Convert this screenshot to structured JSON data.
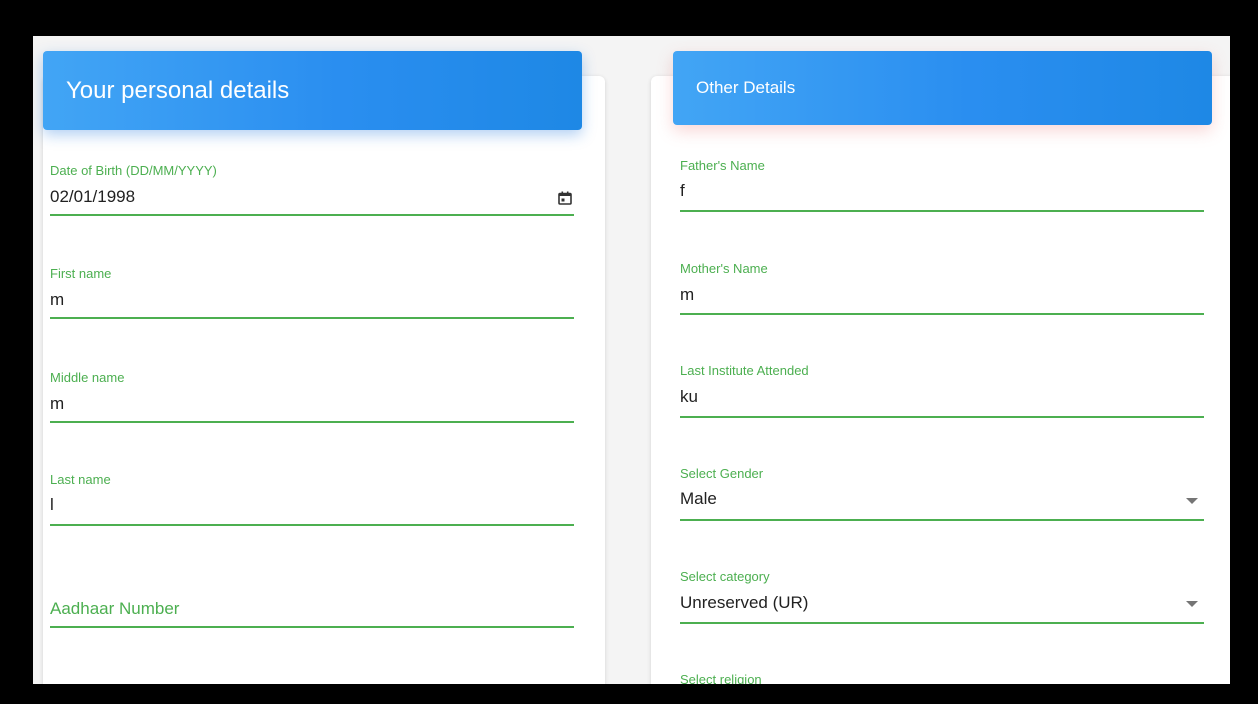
{
  "personal": {
    "title": "Your personal details",
    "dob": {
      "label": "Date of Birth (DD/MM/YYYY)",
      "value": "02/01/1998"
    },
    "first_name": {
      "label": "First name",
      "value": "m"
    },
    "middle_name": {
      "label": "Middle name",
      "value": "m"
    },
    "last_name": {
      "label": "Last name",
      "value": "l"
    },
    "aadhaar": {
      "label": "Aadhaar Number"
    }
  },
  "other": {
    "title": "Other Details",
    "father": {
      "label": "Father's Name",
      "value": "f"
    },
    "mother": {
      "label": "Mother's Name",
      "value": "m"
    },
    "institute": {
      "label": "Last Institute Attended",
      "value": "ku"
    },
    "gender": {
      "label": "Select Gender",
      "value": "Male"
    },
    "category": {
      "label": "Select category",
      "value": "Unreserved (UR)"
    },
    "religion": {
      "label": "Select religion"
    }
  },
  "theme": {
    "accent": "#4caf50",
    "header": "#2a8ef0"
  }
}
